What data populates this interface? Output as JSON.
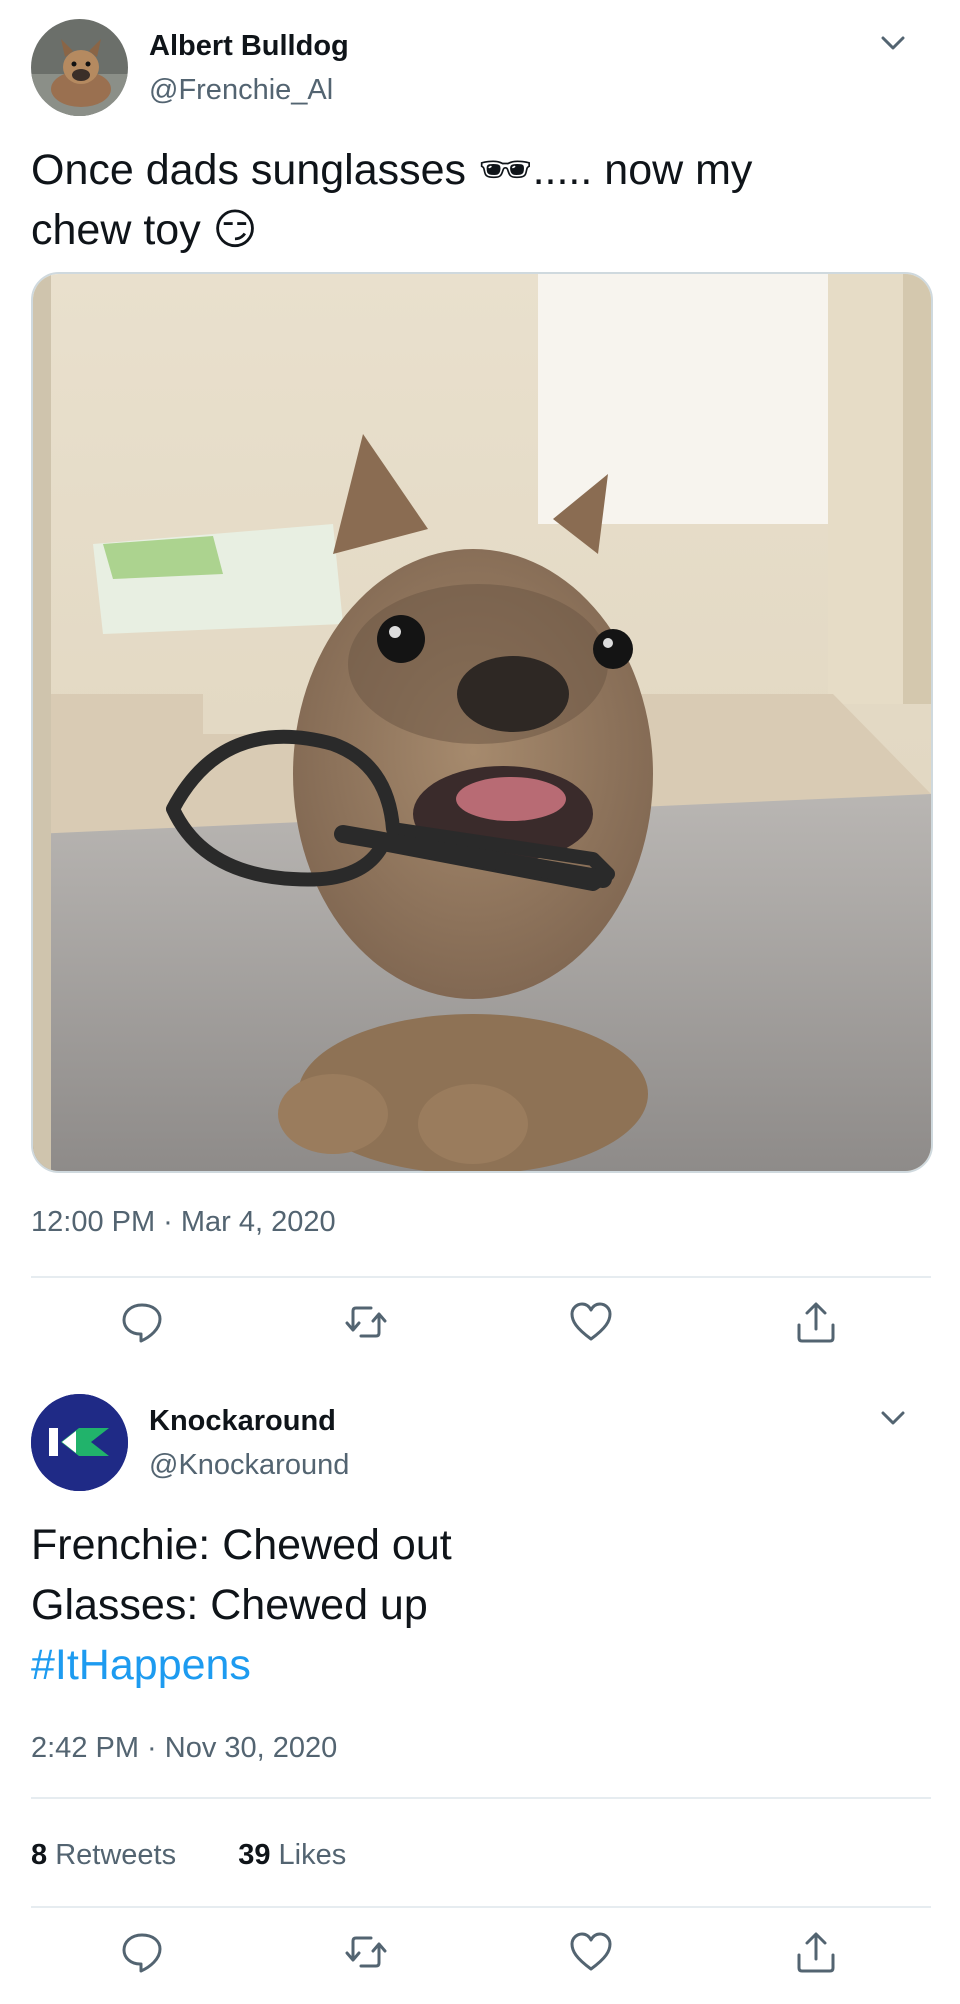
{
  "tweet1": {
    "name": "Albert Bulldog",
    "handle": "@Frenchie_Al",
    "text_line1_before": "Once dads sunglasses ",
    "text_line1_after": "..... now my",
    "text_line2": "chew toy ",
    "emoji_sunglasses": "🕶",
    "emoji_smirk": "😏",
    "timestamp": "12:00 PM · Mar 4, 2020",
    "photo_icon": "photo-french-bulldog-with-glasses"
  },
  "tweet2": {
    "name": "Knockaround",
    "handle": "@Knockaround",
    "line1": "Frenchie: Chewed out",
    "line2": "Glasses: Chewed up",
    "hashtag": "#ItHappens",
    "timestamp": "2:42 PM · Nov 30, 2020",
    "retweets_count": "8",
    "retweets_label": " Retweets",
    "likes_count": "39",
    "likes_label": " Likes"
  },
  "colors": {
    "link": "#1d9bf0",
    "secondary_text": "#536471",
    "divider": "#e6ecf0",
    "knockaround_brand_bg": "#1f2a86",
    "knockaround_brand_green": "#21b36b"
  },
  "icons": [
    "reply-icon",
    "retweet-icon",
    "like-icon",
    "share-icon",
    "chevron-down-icon"
  ]
}
